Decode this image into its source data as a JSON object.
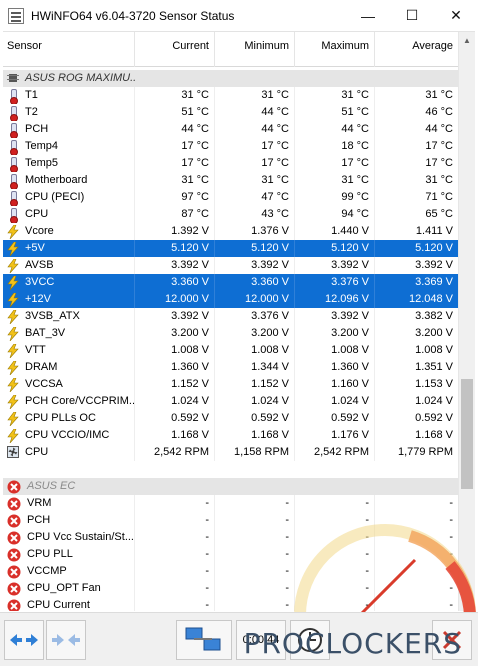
{
  "window": {
    "title": "HWiNFO64 v6.04-3720 Sensor Status",
    "minimize_glyph": "—",
    "maximize_glyph": "☐",
    "close_glyph": "✕"
  },
  "columns": {
    "sensor": "Sensor",
    "current": "Current",
    "minimum": "Minimum",
    "maximum": "Maximum",
    "average": "Average"
  },
  "groups": [
    {
      "name": "ASUS ROG MAXIMU...",
      "disabled": false,
      "rows": [
        {
          "icon": "thermometer-icon",
          "name": "T1",
          "current": "31 °C",
          "minimum": "31 °C",
          "maximum": "31 °C",
          "average": "31 °C"
        },
        {
          "icon": "thermometer-icon",
          "name": "T2",
          "current": "51 °C",
          "minimum": "44 °C",
          "maximum": "51 °C",
          "average": "46 °C"
        },
        {
          "icon": "thermometer-icon",
          "name": "PCH",
          "current": "44 °C",
          "minimum": "44 °C",
          "maximum": "44 °C",
          "average": "44 °C"
        },
        {
          "icon": "thermometer-icon",
          "name": "Temp4",
          "current": "17 °C",
          "minimum": "17 °C",
          "maximum": "18 °C",
          "average": "17 °C"
        },
        {
          "icon": "thermometer-icon",
          "name": "Temp5",
          "current": "17 °C",
          "minimum": "17 °C",
          "maximum": "17 °C",
          "average": "17 °C"
        },
        {
          "icon": "thermometer-icon",
          "name": "Motherboard",
          "current": "31 °C",
          "minimum": "31 °C",
          "maximum": "31 °C",
          "average": "31 °C"
        },
        {
          "icon": "thermometer-icon",
          "name": "CPU (PECI)",
          "current": "97 °C",
          "minimum": "47 °C",
          "maximum": "99 °C",
          "average": "71 °C"
        },
        {
          "icon": "thermometer-icon",
          "name": "CPU",
          "current": "87 °C",
          "minimum": "43 °C",
          "maximum": "94 °C",
          "average": "65 °C"
        },
        {
          "icon": "voltage-icon",
          "name": "Vcore",
          "current": "1.392 V",
          "minimum": "1.376 V",
          "maximum": "1.440 V",
          "average": "1.411 V"
        },
        {
          "icon": "voltage-icon",
          "name": "+5V",
          "current": "5.120 V",
          "minimum": "5.120 V",
          "maximum": "5.120 V",
          "average": "5.120 V",
          "selected": true
        },
        {
          "icon": "voltage-icon",
          "name": "AVSB",
          "current": "3.392 V",
          "minimum": "3.392 V",
          "maximum": "3.392 V",
          "average": "3.392 V"
        },
        {
          "icon": "voltage-icon",
          "name": "3VCC",
          "current": "3.360 V",
          "minimum": "3.360 V",
          "maximum": "3.376 V",
          "average": "3.369 V",
          "selected": true
        },
        {
          "icon": "voltage-icon",
          "name": "+12V",
          "current": "12.000 V",
          "minimum": "12.000 V",
          "maximum": "12.096 V",
          "average": "12.048 V",
          "selected": true
        },
        {
          "icon": "voltage-icon",
          "name": "3VSB_ATX",
          "current": "3.392 V",
          "minimum": "3.376 V",
          "maximum": "3.392 V",
          "average": "3.382 V"
        },
        {
          "icon": "voltage-icon",
          "name": "BAT_3V",
          "current": "3.200 V",
          "minimum": "3.200 V",
          "maximum": "3.200 V",
          "average": "3.200 V"
        },
        {
          "icon": "voltage-icon",
          "name": "VTT",
          "current": "1.008 V",
          "minimum": "1.008 V",
          "maximum": "1.008 V",
          "average": "1.008 V"
        },
        {
          "icon": "voltage-icon",
          "name": "DRAM",
          "current": "1.360 V",
          "minimum": "1.344 V",
          "maximum": "1.360 V",
          "average": "1.351 V"
        },
        {
          "icon": "voltage-icon",
          "name": "VCCSA",
          "current": "1.152 V",
          "minimum": "1.152 V",
          "maximum": "1.160 V",
          "average": "1.153 V"
        },
        {
          "icon": "voltage-icon",
          "name": "PCH Core/VCCPRIM...",
          "current": "1.024 V",
          "minimum": "1.024 V",
          "maximum": "1.024 V",
          "average": "1.024 V"
        },
        {
          "icon": "voltage-icon",
          "name": "CPU PLLs OC",
          "current": "0.592 V",
          "minimum": "0.592 V",
          "maximum": "0.592 V",
          "average": "0.592 V"
        },
        {
          "icon": "voltage-icon",
          "name": "CPU VCCIO/IMC",
          "current": "1.168 V",
          "minimum": "1.168 V",
          "maximum": "1.176 V",
          "average": "1.168 V"
        },
        {
          "icon": "fan-icon",
          "name": "CPU",
          "current": "2,542 RPM",
          "minimum": "1,158 RPM",
          "maximum": "2,542 RPM",
          "average": "1,779 RPM"
        }
      ]
    },
    {
      "name": "ASUS EC",
      "disabled": true,
      "rows": [
        {
          "icon": "error-icon",
          "name": "VRM",
          "current": "-",
          "minimum": "-",
          "maximum": "-",
          "average": "-"
        },
        {
          "icon": "error-icon",
          "name": "PCH",
          "current": "-",
          "minimum": "-",
          "maximum": "-",
          "average": "-"
        },
        {
          "icon": "error-icon",
          "name": "CPU Vcc Sustain/St...",
          "current": "-",
          "minimum": "-",
          "maximum": "-",
          "average": "-"
        },
        {
          "icon": "error-icon",
          "name": "CPU PLL",
          "current": "-",
          "minimum": "-",
          "maximum": "-",
          "average": "-"
        },
        {
          "icon": "error-icon",
          "name": "VCCMP",
          "current": "-",
          "minimum": "-",
          "maximum": "-",
          "average": "-"
        },
        {
          "icon": "error-icon",
          "name": "CPU_OPT Fan",
          "current": "-",
          "minimum": "-",
          "maximum": "-",
          "average": "-"
        },
        {
          "icon": "error-icon",
          "name": "CPU Current",
          "current": "-",
          "minimum": "-",
          "maximum": "-",
          "average": "-"
        }
      ]
    }
  ],
  "toolbar": {
    "elapsed": "0:00:44",
    "watermark": "PROCLOCKERS"
  },
  "colors": {
    "selection": "#0e6ed3",
    "group_band": "#e5e5e5"
  }
}
